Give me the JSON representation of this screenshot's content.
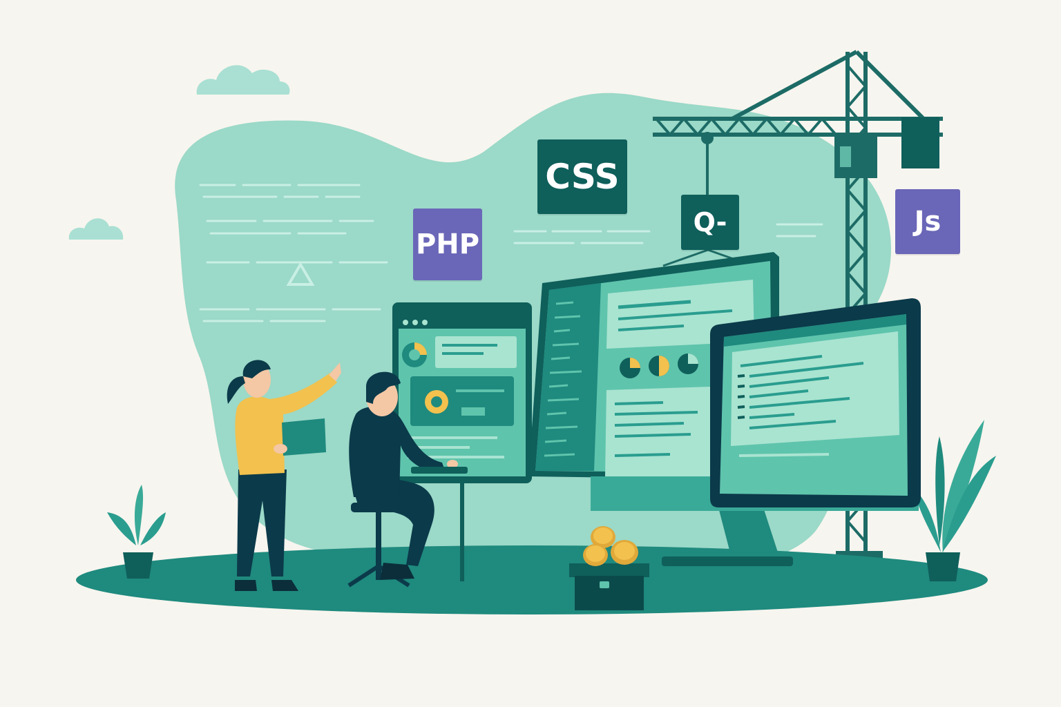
{
  "colors": {
    "background": "#f7f5ef",
    "blob": "#9bd9c8",
    "teal_dark": "#0f5f5b",
    "teal_mid": "#2a9d8f",
    "teal_light": "#a9e4d1",
    "navy": "#0b3a4a",
    "yellow": "#f2c14e",
    "purple": "#6a67b8",
    "cloud": "#a9e0d3"
  },
  "tags": {
    "css": "CSS",
    "php": "PHP",
    "js": "Js",
    "search": "Q-"
  }
}
